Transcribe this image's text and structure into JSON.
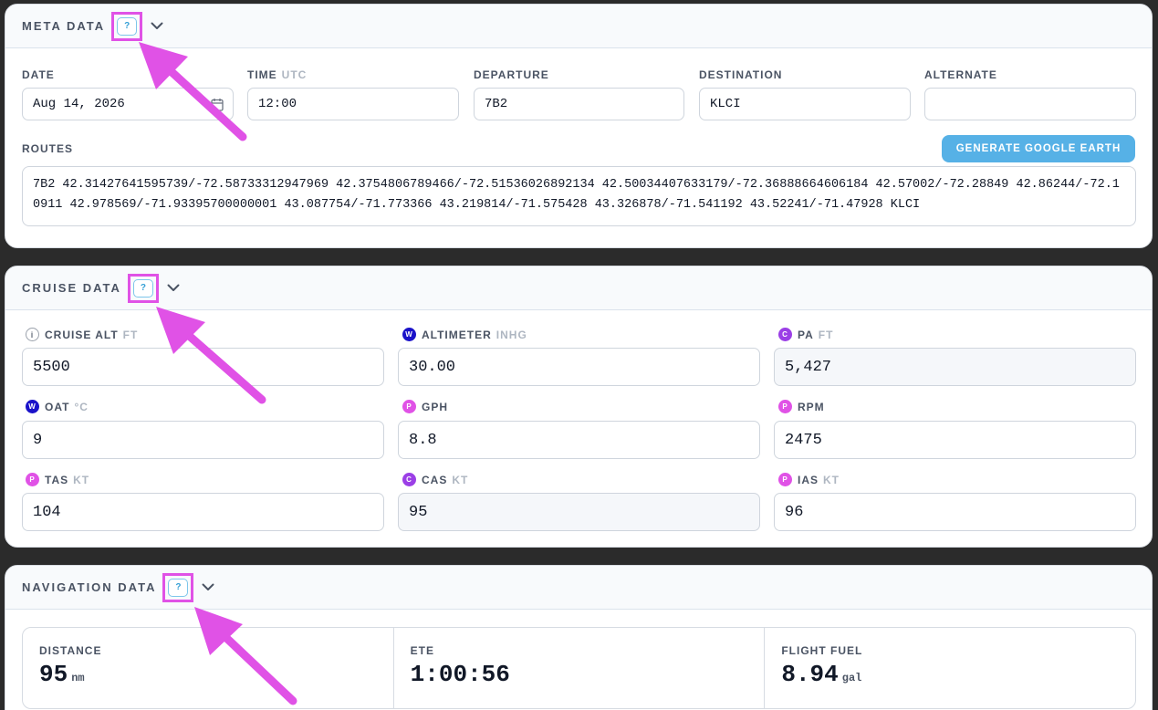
{
  "colors": {
    "highlight": "#e052e6",
    "accent": "#56b1e6",
    "badge_w": "#1a12c9",
    "badge_p": "#e052e6",
    "badge_c": "#9b3fe6"
  },
  "meta": {
    "title": "META DATA",
    "help": "?",
    "date": {
      "label": "DATE",
      "value": "Aug 14, 2026"
    },
    "time": {
      "label": "TIME",
      "unit": "UTC",
      "value": "12:00"
    },
    "departure": {
      "label": "DEPARTURE",
      "value": "7B2"
    },
    "destination": {
      "label": "DESTINATION",
      "value": "KLCI"
    },
    "alternate": {
      "label": "ALTERNATE",
      "value": ""
    },
    "routes": {
      "label": "ROUTES",
      "button": "GENERATE GOOGLE EARTH",
      "value": "7B2 42.31427641595739/-72.58733312947969 42.3754806789466/-72.51536026892134 42.50034407633179/-72.36888664606184 42.57002/-72.28849 42.86244/-72.10911 42.978569/-71.93395700000001 43.087754/-71.773366 43.219814/-71.575428 43.326878/-71.541192 43.52241/-71.47928 KLCI"
    }
  },
  "cruise": {
    "title": "CRUISE DATA",
    "help": "?",
    "fields": [
      {
        "badge": "i",
        "label": "CRUISE ALT",
        "unit": "FT",
        "value": "5500"
      },
      {
        "badge": "W",
        "label": "ALTIMETER",
        "unit": "INHG",
        "value": "30.00"
      },
      {
        "badge": "C",
        "label": "PA",
        "unit": "FT",
        "value": "5,427"
      },
      {
        "badge": "W",
        "label": "OAT",
        "unit": "°C",
        "value": "9"
      },
      {
        "badge": "P",
        "label": "GPH",
        "unit": "",
        "value": "8.8"
      },
      {
        "badge": "P",
        "label": "RPM",
        "unit": "",
        "value": "2475"
      },
      {
        "badge": "P",
        "label": "TAS",
        "unit": "KT",
        "value": "104"
      },
      {
        "badge": "C",
        "label": "CAS",
        "unit": "KT",
        "value": "95"
      },
      {
        "badge": "P",
        "label": "IAS",
        "unit": "KT",
        "value": "96"
      }
    ]
  },
  "navigation": {
    "title": "NAVIGATION DATA",
    "help": "?",
    "stats": [
      {
        "label": "DISTANCE",
        "value": "95",
        "unit": "nm"
      },
      {
        "label": "ETE",
        "value": "1:00:56",
        "unit": ""
      },
      {
        "label": "FLIGHT FUEL",
        "value": "8.94",
        "unit": "gal"
      }
    ]
  }
}
